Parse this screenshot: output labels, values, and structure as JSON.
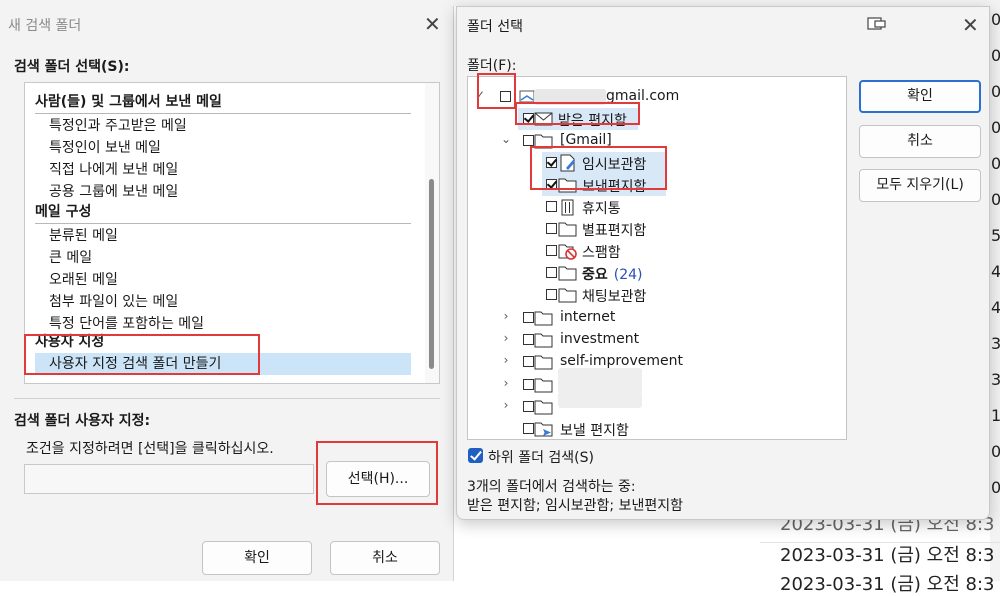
{
  "background_list": {
    "rows": [
      {
        "text": "2023-03-31 (금) 오전 8:3"
      },
      {
        "text": "2023-03-31 (금) 오전 8:3"
      },
      {
        "text": "2023-03-31 (금) 오전 8:3"
      }
    ],
    "right_edge_digits": [
      "0",
      "0",
      "0",
      "0",
      "0",
      "0",
      "5",
      "4",
      "4",
      "3",
      "3",
      "1",
      "0",
      "0"
    ]
  },
  "left_dialog": {
    "title": "새 검색 폴더",
    "select_label": "검색 폴더 선택(S):",
    "groups": [
      {
        "header": "사람(들) 및 그룹에서 보낸 메일",
        "items": [
          "특정인과 주고받은 메일",
          "특정인이 보낸 메일",
          "직접 나에게 보낸 메일",
          "공용 그룹에 보낸 메일"
        ]
      },
      {
        "header": "메일 구성",
        "items": [
          "분류된 메일",
          "큰 메일",
          "오래된 메일",
          "첨부 파일이 있는 메일",
          "특정 단어를 포함하는 메일"
        ]
      },
      {
        "header": "사용자 지정",
        "items": [
          "사용자 지정 검색 폴더 만들기"
        ]
      }
    ],
    "custom_label": "검색 폴더 사용자 지정:",
    "instruction": "조건을 지정하려면 [선택]을 클릭하십시오.",
    "choose_button": "선택(H)...",
    "ok_button": "확인",
    "cancel_button": "취소"
  },
  "right_dialog": {
    "title": "폴더 선택",
    "folder_label": "폴더(F):",
    "account_suffix": "gmail.com",
    "folders": {
      "inbox": "받은 편지함",
      "gmail": "[Gmail]",
      "drafts": "임시보관함",
      "sent": "보낸편지함",
      "trash": "휴지통",
      "starred": "별표편지함",
      "spam": "스팸함",
      "important": "중요",
      "important_count": "(24)",
      "chats": "채팅보관함",
      "internet": "internet",
      "investment": "investment",
      "self_improvement": "self-improvement",
      "outbox": "보낼 편지함"
    },
    "ok_button": "확인",
    "cancel_button": "취소",
    "clear_all_button": "모두 지우기(L)",
    "subfolder_label": "하위 폴더 검색(S)",
    "summary_line1": "3개의 폴더에서 검색하는 중:",
    "summary_line2": "받은 편지함; 임시보관함; 보낸편지함"
  },
  "colors": {
    "accent": "#1f5fbf",
    "selection": "#cce4f7",
    "annotation": "#e23a3a"
  }
}
